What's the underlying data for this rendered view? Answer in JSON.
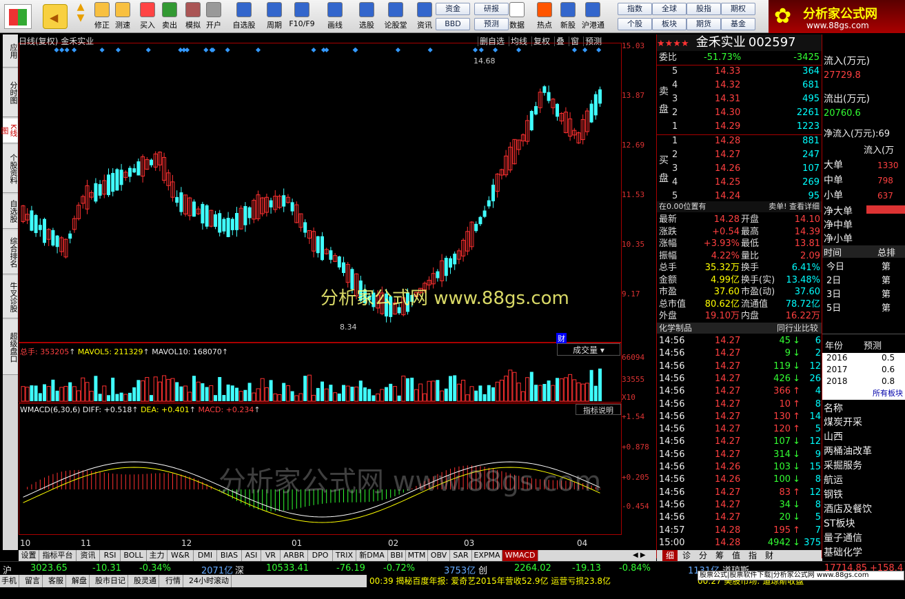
{
  "toolbar": {
    "buttons": [
      "修正",
      "测速",
      "买入",
      "卖出",
      "模拟",
      "开户",
      "自选股",
      "周期",
      "F10/F9",
      "画线",
      "选股",
      "论股堂",
      "资讯",
      "数据",
      "热点",
      "新股",
      "沪港通"
    ],
    "groups_top": [
      "资金",
      "研报",
      "指数",
      "全球",
      "股指",
      "期权"
    ],
    "groups_bottom": [
      "BBD",
      "预测",
      "个股",
      "板块",
      "期货",
      "基金"
    ],
    "logo": "分析家公式网",
    "logo_url": "www.88gs.com"
  },
  "sidebar": [
    "应用",
    "分时图",
    "K线图",
    "个股资料",
    "自选股",
    "综合排名",
    "牛叉诊股",
    "超级盘口"
  ],
  "chart": {
    "title": "日线(复权)",
    "name": "金禾实业",
    "tools": [
      "删自选",
      "均线",
      "复权",
      "叠",
      "窗",
      "预测"
    ],
    "high_label": "14.68",
    "low_label": "8.34",
    "fin_label": "财",
    "vol_header": {
      "total": "总手: 353205",
      "mavol5": "MAVOL5: 211329",
      "mavol10": "MAVOL10: 168070"
    },
    "vol_dropdown": "成交量",
    "macd_header": {
      "name": "WMACD(6,30,6)",
      "diff": "DIFF: +0.518",
      "dea": "DEA: +0.401",
      "macd": "MACD: +0.234"
    },
    "indicator_help": "指标说明",
    "x_labels": [
      "10",
      "11",
      "12",
      "01",
      "02",
      "03",
      "04"
    ],
    "watermark1": "分析家公式网 www.88gs.com",
    "watermark2": "分析家公式网 www.88gs.com"
  },
  "axis": {
    "price": [
      "15.03",
      "13.87",
      "12.69",
      "11.53",
      "10.35",
      "9.17"
    ],
    "vol": [
      "66094",
      "33555",
      "X10"
    ],
    "macd": [
      "+1.54",
      "+0.878",
      "+0.205",
      "-0.454"
    ]
  },
  "quote": {
    "stars": "★★★★",
    "name": "金禾实业",
    "code": "002597",
    "weibi_label": "委比",
    "weibi": "-51.73%",
    "weicha": "-3425",
    "sell_label": "卖盘",
    "buy_label": "买盘",
    "asks": [
      {
        "lv": "5",
        "p": "14.33",
        "v": "364"
      },
      {
        "lv": "4",
        "p": "14.32",
        "v": "681"
      },
      {
        "lv": "3",
        "p": "14.31",
        "v": "495"
      },
      {
        "lv": "2",
        "p": "14.30",
        "v": "2261"
      },
      {
        "lv": "1",
        "p": "14.29",
        "v": "1223"
      }
    ],
    "bids": [
      {
        "lv": "1",
        "p": "14.28",
        "v": "881"
      },
      {
        "lv": "2",
        "p": "14.27",
        "v": "247"
      },
      {
        "lv": "3",
        "p": "14.26",
        "v": "107"
      },
      {
        "lv": "4",
        "p": "14.25",
        "v": "269"
      },
      {
        "lv": "5",
        "p": "14.24",
        "v": "95"
      }
    ],
    "pos_label": "在0.00位置有",
    "pos_right": "卖单! 查看详细",
    "stats": [
      [
        "最新",
        "14.28",
        "开盘",
        "14.10"
      ],
      [
        "涨跌",
        "+0.54",
        "最高",
        "14.39"
      ],
      [
        "涨幅",
        "+3.93%",
        "最低",
        "13.81"
      ],
      [
        "振幅",
        "4.22%",
        "量比",
        "2.09"
      ],
      [
        "总手",
        "35.32万",
        "换手",
        "6.41%"
      ],
      [
        "金额",
        "4.99亿",
        "换手(实)",
        "13.48%"
      ],
      [
        "市盈",
        "37.60",
        "市盈(动)",
        "37.60"
      ],
      [
        "总市值",
        "80.62亿",
        "流通值",
        "78.72亿"
      ],
      [
        "外盘",
        "19.10万",
        "内盘",
        "16.22万"
      ]
    ],
    "industry": "化学制品",
    "industry_cmp": "同行业比较",
    "ticks": [
      [
        "14:56",
        "14.27",
        "45",
        "6"
      ],
      [
        "14:56",
        "14.27",
        "9",
        "2"
      ],
      [
        "14:56",
        "14.27",
        "119",
        "12"
      ],
      [
        "14:56",
        "14.27",
        "426",
        "26"
      ],
      [
        "14:56",
        "14.27",
        "366",
        "4"
      ],
      [
        "14:56",
        "14.27",
        "10",
        "8"
      ],
      [
        "14:56",
        "14.27",
        "130",
        "14"
      ],
      [
        "14:56",
        "14.27",
        "120",
        "5"
      ],
      [
        "14:56",
        "14.27",
        "107",
        "12"
      ],
      [
        "14:56",
        "14.27",
        "314",
        "9"
      ],
      [
        "14:56",
        "14.26",
        "103",
        "15"
      ],
      [
        "14:56",
        "14.26",
        "100",
        "8"
      ],
      [
        "14:56",
        "14.27",
        "83",
        "12"
      ],
      [
        "14:56",
        "14.27",
        "34",
        "8"
      ],
      [
        "14:56",
        "14.27",
        "20",
        "5"
      ],
      [
        "14:57",
        "14.28",
        "195",
        "7"
      ],
      [
        "15:00",
        "14.28",
        "4942",
        "375"
      ]
    ],
    "tick_dirs": [
      "dn",
      "dn",
      "dn",
      "dn",
      "up",
      "up",
      "up",
      "up",
      "dn",
      "dn",
      "dn",
      "dn",
      "up",
      "dn",
      "dn",
      "up",
      "dn"
    ]
  },
  "far": {
    "inflow_label": "流入(万元)",
    "inflow": "27729.8",
    "outflow_label": "流出(万元)",
    "outflow": "20760.6",
    "net_label": "净流入(万元):69",
    "flow2": "流入(万",
    "rows": [
      [
        "大单",
        "1330"
      ],
      [
        "中单",
        "798"
      ],
      [
        "小单",
        "637"
      ]
    ],
    "net_rows": [
      "净大单",
      "净中单",
      "净小单"
    ],
    "time_h": "时间",
    "total_h": "总排",
    "days": [
      [
        "今日",
        "第"
      ],
      [
        "2日",
        "第"
      ],
      [
        "3日",
        "第"
      ],
      [
        "5日",
        "第"
      ]
    ],
    "year_h": "年份",
    "pred_h": "预测",
    "years": [
      [
        "2016",
        "0.5"
      ],
      [
        "2017",
        "0.6"
      ],
      [
        "2018",
        "0.8"
      ]
    ],
    "all": "所有板块",
    "name_h": "名称",
    "sectors": [
      "煤炭开采",
      "山西",
      "两桶油改革",
      "采掘服务",
      "航运",
      "钢铁",
      "酒店及餐饮",
      "ST板块",
      "量子通信",
      "基础化学"
    ]
  },
  "bottom_tabs": [
    "设置",
    "指标平台",
    "资讯",
    "RSI",
    "BOLL",
    "主力",
    "W&R",
    "DMI",
    "BIAS",
    "ASI",
    "VR",
    "ARBR",
    "DPO",
    "TRIX",
    "新DMA",
    "BBI",
    "MTM",
    "OBV",
    "SAR",
    "EXPMA",
    "WMACD"
  ],
  "right_tabs": [
    "细",
    "诊",
    "分",
    "筹",
    "值",
    "指",
    "财"
  ],
  "index": {
    "sh": "沪",
    "sh_v": "3023.65",
    "sh_c": "-10.31",
    "sh_p": "-0.34%",
    "sh_a": "2071亿",
    "sz": "深",
    "sz_v": "10533.41",
    "sz_c": "-76.19",
    "sz_p": "-0.72%",
    "sz_a": "3753亿",
    "cy": "创",
    "cy_v": "2264.02",
    "cy_c": "-19.13",
    "cy_p": "-0.84%",
    "amt": "1131亿",
    "dj": "道琼斯",
    "dj_v": "17714.85",
    "dj_c": "+158.4"
  },
  "status": {
    "items": [
      "手机",
      "留言",
      "客服",
      "解盘",
      "股市日记",
      "股灵通",
      "行情",
      "24小时滚动"
    ],
    "news": "00:39 揭秘百度年报: 爱奇艺2015年营收52.9亿 运营亏损23.8亿",
    "news2": "00:27 美股市场: 道琼斯收盘",
    "ad": "股票公式|股票软件下载|分析家公式网 www.88gs.com"
  }
}
